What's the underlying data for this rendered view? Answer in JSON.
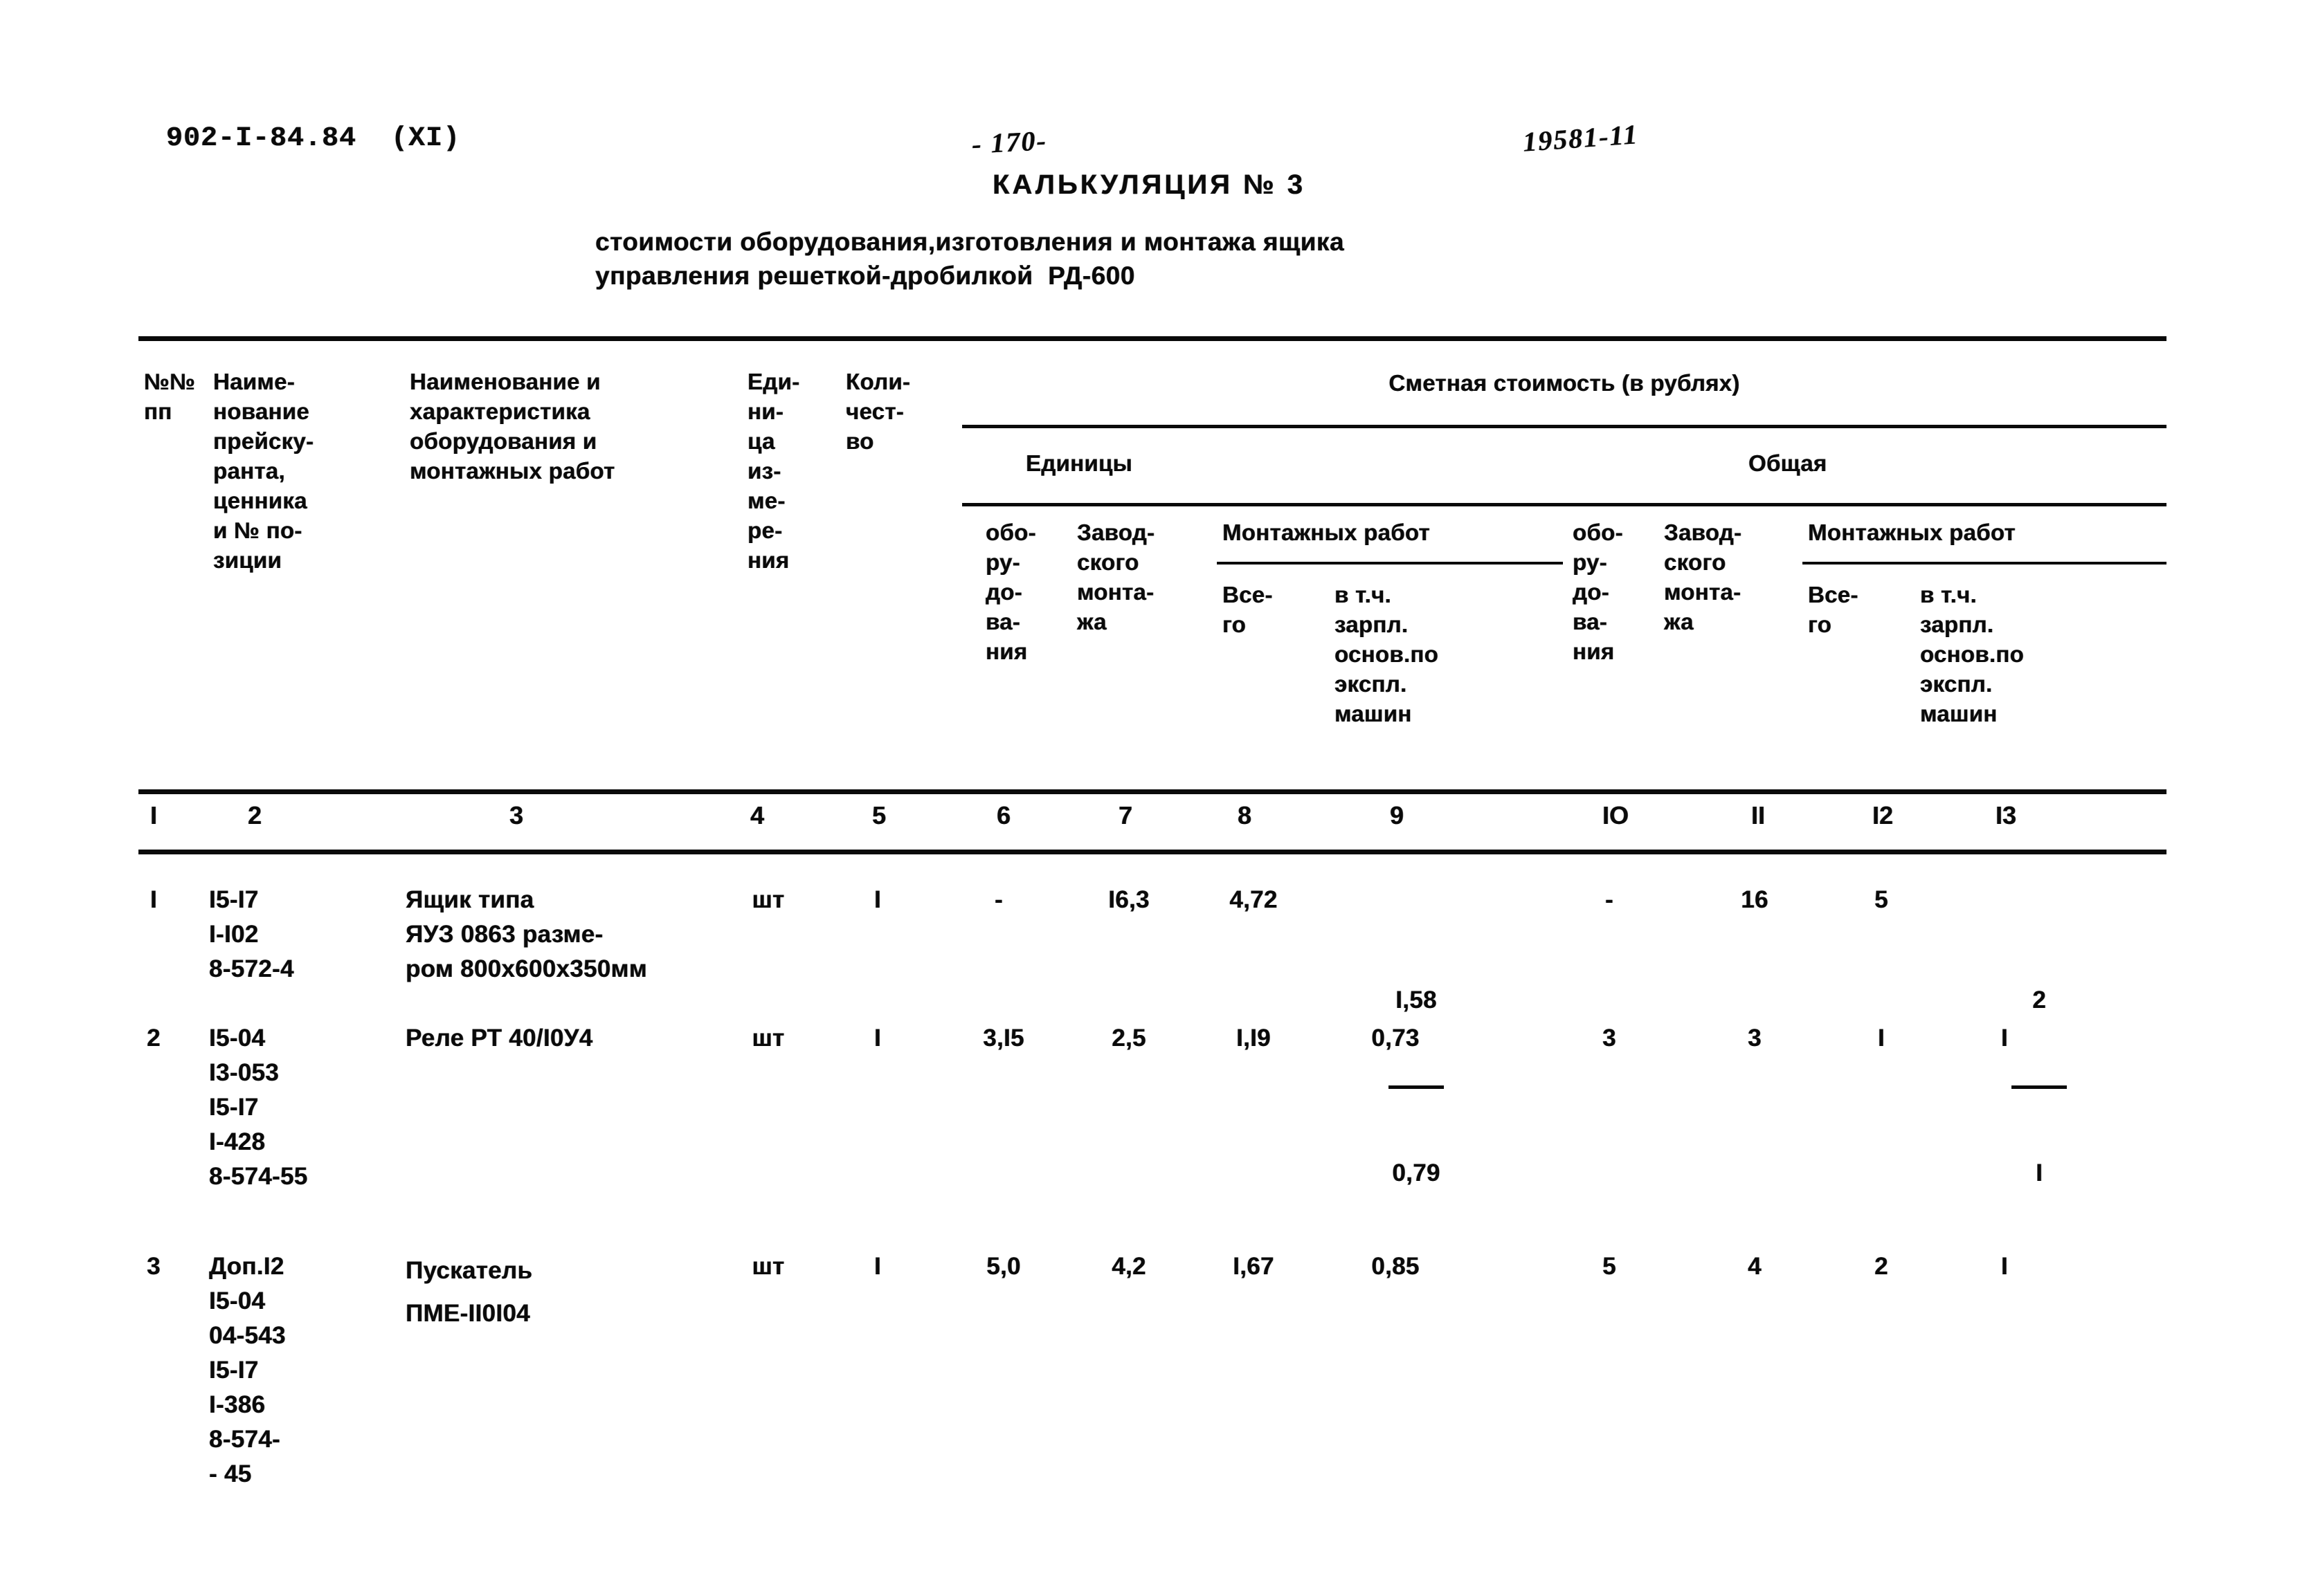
{
  "header": {
    "doc_code": "902-I-84.84  (XI)",
    "page_number": "- 170-",
    "archive_stamp": "19581-11"
  },
  "title": {
    "main": "КАЛЬКУЛЯЦИЯ № 3",
    "subtitle_line1": "стоимости оборудования,изготовления и монтажа ящика",
    "subtitle_line2": "управления решеткой-дробилкой  РД-600"
  },
  "table": {
    "col1_header": "№№\nпп",
    "col2_header": "Наиме-\nнование\nпрейску-\nранта,\nценника\nи № по-\nзиции",
    "col3_header": "Наименование и\nхарактеристика\nоборудования и\nмонтажных работ",
    "col4_header": "Еди-\nни-\nца\nиз-\nме-\nре-\nния",
    "col5_header": "Коли-\nчест-\nво",
    "group_header": "Сметная стоимость (в рублях)",
    "subgroup_unit": "Единицы",
    "subgroup_total": "Общая",
    "col6_header": "обо-\nру-\nдо-\nва-\nния",
    "col7_header": "Завод-\nского\nмонта-\nжа",
    "montazh_header": "Монтажных работ",
    "col8_header": "Все-\nго",
    "col9_header": "в т.ч.\nзарпл.\nоснов.по\nэкспл.\nмашин",
    "col10_header": "обо-\nру-\nдо-\nва-\nния",
    "col11_header": "Завод-\nского\nмонта-\nжа",
    "montazh_header2": "Монтажных работ",
    "col12_header": "Все-\nго",
    "col13_header": "в т.ч.\nзарпл.\nоснов.по\nэкспл.\nмашин",
    "column_numbers": [
      "I",
      "2",
      "3",
      "4",
      "5",
      "6",
      "7",
      "8",
      "9",
      "IO",
      "II",
      "I2",
      "I3"
    ],
    "rows": [
      {
        "num": "I",
        "pricelist": "I5-I7\nI-I02\n8-572-4",
        "name": "Ящик типа\nЯУЗ 0863 разме-\nром 800х600х350мм",
        "unit": "шт",
        "qty": "I",
        "u_equip": "-",
        "u_factory": "I6,3",
        "u_mont_total": "4,72",
        "u_mont_salary_num": "I,58",
        "u_mont_salary_den": "0,79",
        "t_equip": "-",
        "t_factory": "16",
        "t_mont_total": "5",
        "t_mont_salary_num": "2",
        "t_mont_salary_den": "I"
      },
      {
        "num": "2",
        "pricelist": "I5-04\nI3-053\nI5-I7\nI-428\n8-574-55",
        "name": "Реле РТ 40/I0У4",
        "unit": "шт",
        "qty": "I",
        "u_equip": "3,I5",
        "u_factory": "2,5",
        "u_mont_total": "I,I9",
        "u_mont_salary_num": "0,73",
        "u_mont_salary_den": "",
        "t_equip": "3",
        "t_factory": "3",
        "t_mont_total": "I",
        "t_mont_salary_num": "I",
        "t_mont_salary_den": ""
      },
      {
        "num": "3",
        "pricelist": "Доп.I2\nI5-04\n04-543\nI5-I7\nI-386\n8-574-\n- 45",
        "name": "Пускатель\nПМЕ-II0I04",
        "unit": "шт",
        "qty": "I",
        "u_equip": "5,0",
        "u_factory": "4,2",
        "u_mont_total": "I,67",
        "u_mont_salary_num": "0,85",
        "u_mont_salary_den": "",
        "t_equip": "5",
        "t_factory": "4",
        "t_mont_total": "2",
        "t_mont_salary_num": "I",
        "t_mont_salary_den": ""
      }
    ]
  }
}
